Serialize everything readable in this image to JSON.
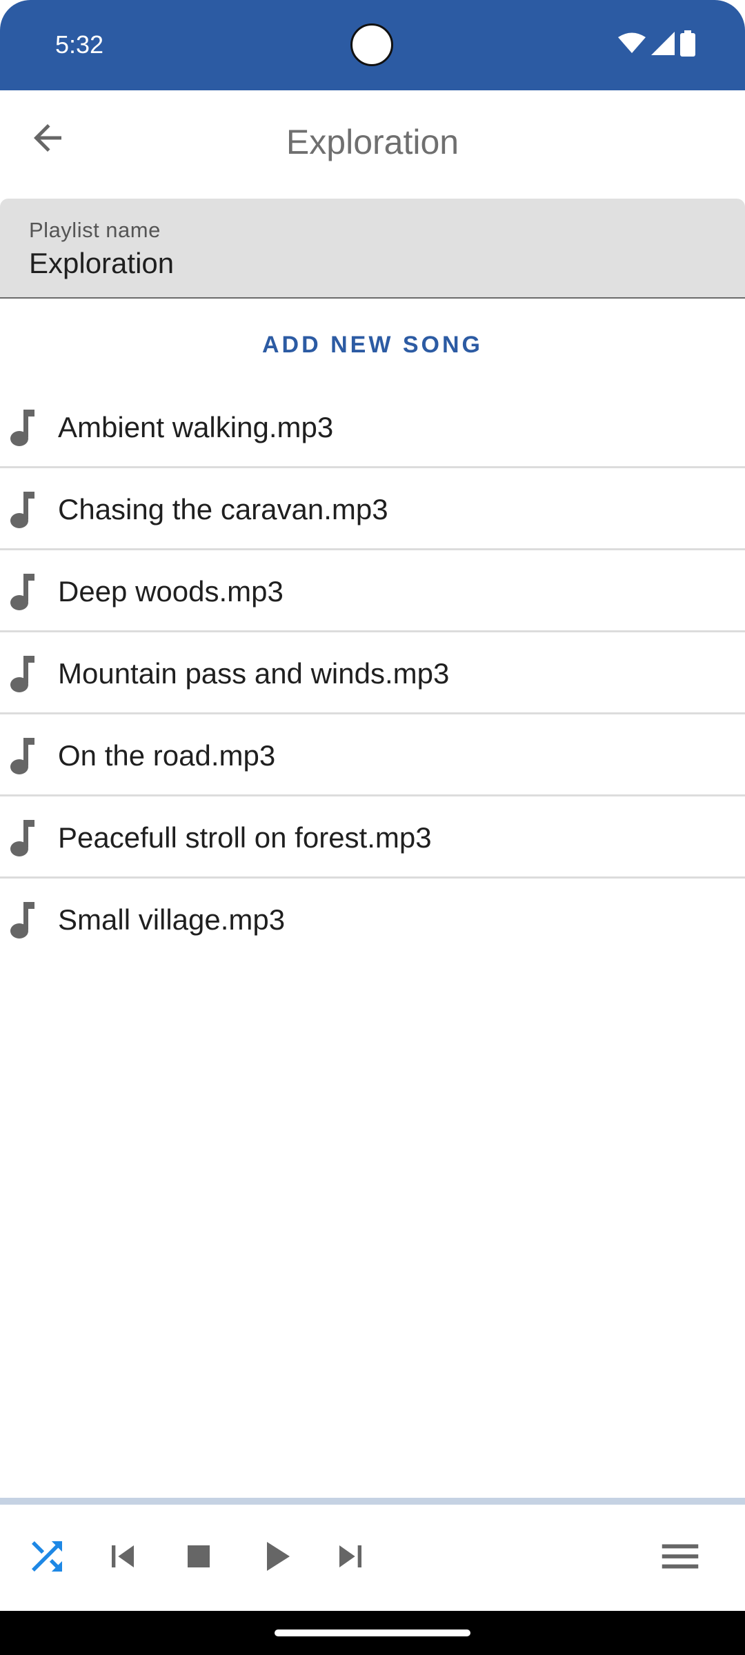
{
  "status_bar": {
    "time": "5:32",
    "icons": [
      "wifi-icon",
      "signal-icon",
      "battery-icon"
    ]
  },
  "app_bar": {
    "title": "Exploration",
    "back_icon": "arrow-back-icon"
  },
  "playlist_name_field": {
    "label": "Playlist name",
    "value": "Exploration"
  },
  "add_song_label": "ADD NEW SONG",
  "songs": [
    {
      "name": "Ambient walking.mp3",
      "icon": "music-note-icon"
    },
    {
      "name": "Chasing the caravan.mp3",
      "icon": "music-note-icon"
    },
    {
      "name": "Deep woods.mp3",
      "icon": "music-note-icon"
    },
    {
      "name": "Mountain pass and winds.mp3",
      "icon": "music-note-icon"
    },
    {
      "name": "On the road.mp3",
      "icon": "music-note-icon"
    },
    {
      "name": "Peacefull stroll on forest.mp3",
      "icon": "music-note-icon"
    },
    {
      "name": "Small village.mp3",
      "icon": "music-note-icon"
    }
  ],
  "player": {
    "progress": 0,
    "controls": [
      "shuffle-icon",
      "skip-previous-icon",
      "stop-icon",
      "play-icon",
      "skip-next-icon",
      "menu-icon"
    ],
    "shuffle_active": true
  },
  "colors": {
    "primary": "#2c5ba3",
    "shuffle_active": "#1e88e5",
    "icon_gray": "#666666",
    "field_bg": "#e0e0e0",
    "divider": "#dcdcdc",
    "progress_track": "#c5d2e3"
  }
}
